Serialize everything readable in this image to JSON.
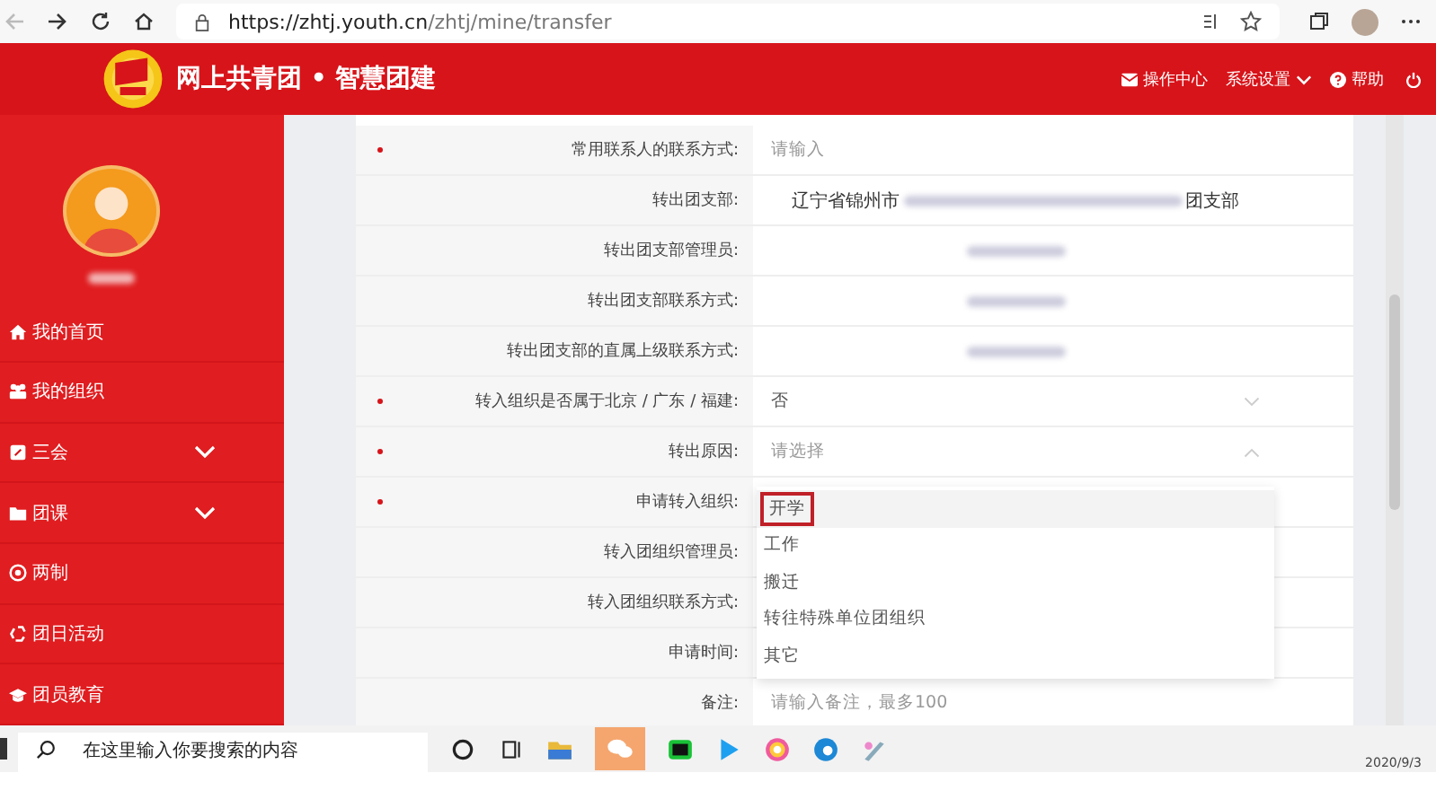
{
  "browser": {
    "url_domain": "https://zhtj.youth.cn",
    "url_path": "/zhtj/mine/transfer"
  },
  "header": {
    "title": "网上共青团 • 智慧团建",
    "links": [
      {
        "label": "操作中心",
        "kind": "mail"
      },
      {
        "label": "系统设置",
        "kind": "dropdown"
      },
      {
        "label": "帮助",
        "kind": "help"
      }
    ]
  },
  "sidebar": {
    "items": [
      {
        "label": "我的首页",
        "kind": "link"
      },
      {
        "label": "我的组织",
        "kind": "link"
      },
      {
        "label": "三会",
        "kind": "group",
        "expanded": false
      },
      {
        "label": "团课",
        "kind": "group",
        "expanded": false
      },
      {
        "label": "两制",
        "kind": "link"
      },
      {
        "label": "团日活动",
        "kind": "link"
      },
      {
        "label": "团员教育",
        "kind": "link"
      }
    ]
  },
  "form": {
    "rows": [
      {
        "label": "常用联系人的联系方式:",
        "required": true,
        "kind": "input",
        "placeholder": "请输入"
      },
      {
        "label": "转出团支部:",
        "required": false,
        "kind": "partly-blurred",
        "prefix": "辽宁省锦州市",
        "suffix": "团支部"
      },
      {
        "label": "转出团支部管理员:",
        "required": false,
        "kind": "blurred"
      },
      {
        "label": "转出团支部联系方式:",
        "required": false,
        "kind": "blurred"
      },
      {
        "label": "转出团支部的直属上级联系方式:",
        "required": false,
        "kind": "blurred"
      },
      {
        "label": "转入组织是否属于北京 / 广东 / 福建:",
        "required": true,
        "kind": "select",
        "value": "否",
        "expanded": false
      },
      {
        "label": "转出原因:",
        "required": true,
        "kind": "select",
        "placeholder": "请选择",
        "expanded": true,
        "options": [
          {
            "label": "开学",
            "selected": true
          },
          {
            "label": "工作",
            "selected": false
          },
          {
            "label": "搬迁",
            "selected": false
          },
          {
            "label": "转往特殊单位团组织",
            "selected": false
          },
          {
            "label": "其它",
            "selected": false
          }
        ]
      },
      {
        "label": "申请转入组织:",
        "required": true,
        "kind": "empty"
      },
      {
        "label": "转入团组织管理员:",
        "required": false,
        "kind": "empty"
      },
      {
        "label": "转入团组织联系方式:",
        "required": false,
        "kind": "empty"
      },
      {
        "label": "申请时间:",
        "required": false,
        "kind": "empty"
      },
      {
        "label": "备注:",
        "required": false,
        "kind": "input",
        "placeholder": "请输入备注，最多100"
      }
    ]
  },
  "taskbar": {
    "search_placeholder": "在这里输入你要搜索的内容",
    "date": "2020/9/3"
  }
}
